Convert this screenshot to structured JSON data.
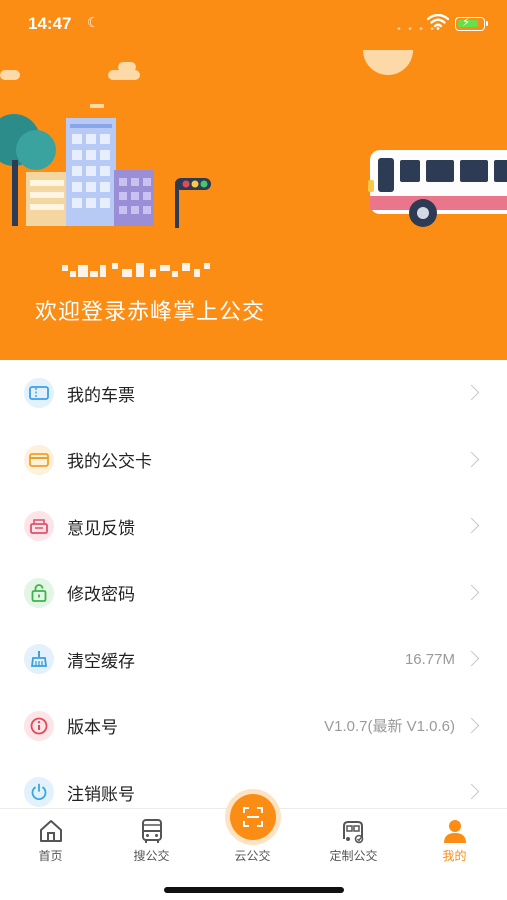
{
  "status_bar": {
    "time": "14:47"
  },
  "header": {
    "welcome_text": "欢迎登录赤峰掌上公交",
    "background_color": "#fb8c14"
  },
  "menu": {
    "items": [
      {
        "label": "我的车票",
        "value": "",
        "icon": "ticket-icon",
        "icon_color": "#3aa0e6",
        "icon_bg": "#e2f1fc"
      },
      {
        "label": "我的公交卡",
        "value": "",
        "icon": "card-icon",
        "icon_color": "#f0a020",
        "icon_bg": "#fdf0dc"
      },
      {
        "label": "意见反馈",
        "value": "",
        "icon": "feedback-icon",
        "icon_color": "#e0506a",
        "icon_bg": "#fde4e8"
      },
      {
        "label": "修改密码",
        "value": "",
        "icon": "lock-icon",
        "icon_color": "#3cb44a",
        "icon_bg": "#e3f5e4"
      },
      {
        "label": "清空缓存",
        "value": "16.77M",
        "icon": "broom-icon",
        "icon_color": "#3a9ee0",
        "icon_bg": "#e2f1fc"
      },
      {
        "label": "版本号",
        "value": "V1.0.7(最新 V1.0.6)",
        "icon": "info-icon",
        "icon_color": "#e24a5a",
        "icon_bg": "#fde4e8"
      },
      {
        "label": "注销账号",
        "value": "",
        "icon": "power-icon",
        "icon_color": "#38a8e0",
        "icon_bg": "#e2f1fc"
      }
    ]
  },
  "tabbar": {
    "tabs": [
      {
        "label": "首页",
        "icon": "home-icon"
      },
      {
        "label": "搜公交",
        "icon": "bus-icon"
      },
      {
        "label": "云公交",
        "icon": "scan-icon"
      },
      {
        "label": "定制公交",
        "icon": "custom-bus-icon"
      },
      {
        "label": "我的",
        "icon": "person-icon",
        "active": true
      }
    ],
    "active_color": "#fb8c14"
  }
}
